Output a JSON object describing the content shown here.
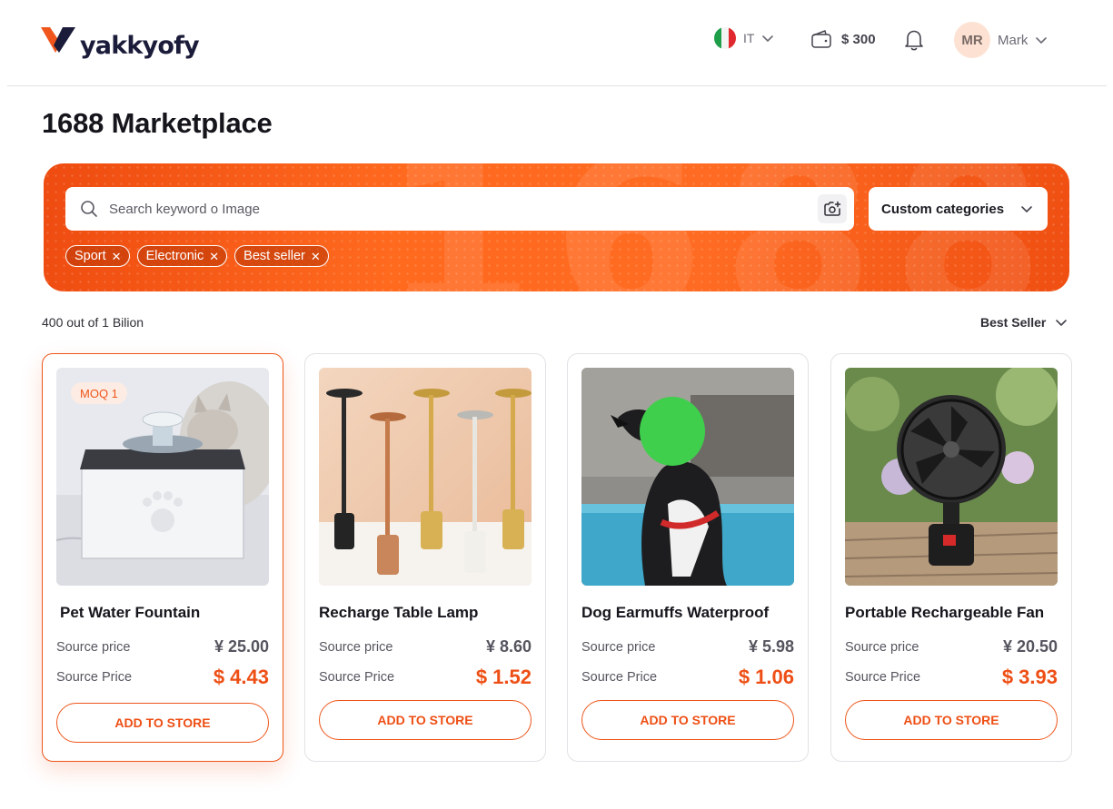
{
  "brand": {
    "name": "yakkyofy"
  },
  "header": {
    "language": {
      "code": "IT"
    },
    "wallet": {
      "amount": "$ 300"
    },
    "user": {
      "initials": "MR",
      "name": "Mark"
    }
  },
  "page": {
    "title": "1688 Marketplace"
  },
  "search": {
    "placeholder": "Search keyword o Image",
    "value": "",
    "category_select": "Custom categories",
    "banner_watermark": "1688",
    "chips": [
      {
        "label": "Sport"
      },
      {
        "label": "Electronic"
      },
      {
        "label": "Best seller"
      }
    ]
  },
  "results": {
    "count_text": "400 out of 1 Bilion",
    "sort_label": "Best Seller"
  },
  "products": [
    {
      "title": "Pet Water Fountain",
      "moq": "MOQ 1",
      "source_label": "Source price",
      "source_value": "¥ 25.00",
      "price_label": "Source Price",
      "price_value": "$ 4.43",
      "button": "ADD TO STORE"
    },
    {
      "title": "Recharge Table Lamp",
      "source_label": "Source price",
      "source_value": "¥ 8.60",
      "price_label": "Source Price",
      "price_value": "$ 1.52",
      "button": "ADD TO STORE"
    },
    {
      "title": "Dog Earmuffs Waterproof",
      "source_label": "Source price",
      "source_value": "¥ 5.98",
      "price_label": "Source Price",
      "price_value": "$ 1.06",
      "button": "ADD TO STORE"
    },
    {
      "title": "Portable Rechargeable Fan",
      "source_label": "Source price",
      "source_value": "¥ 20.50",
      "price_label": "Source Price",
      "price_value": "$ 3.93",
      "button": "ADD TO STORE"
    }
  ],
  "colors": {
    "accent": "#ee5519",
    "price": "#ee4f15",
    "flag_green": "#1f9e4a",
    "flag_red": "#e0282e"
  },
  "icons": [
    "logo-mark-icon",
    "chevron-down-icon",
    "wallet-icon",
    "bell-icon",
    "search-icon",
    "camera-icon",
    "close-icon"
  ]
}
